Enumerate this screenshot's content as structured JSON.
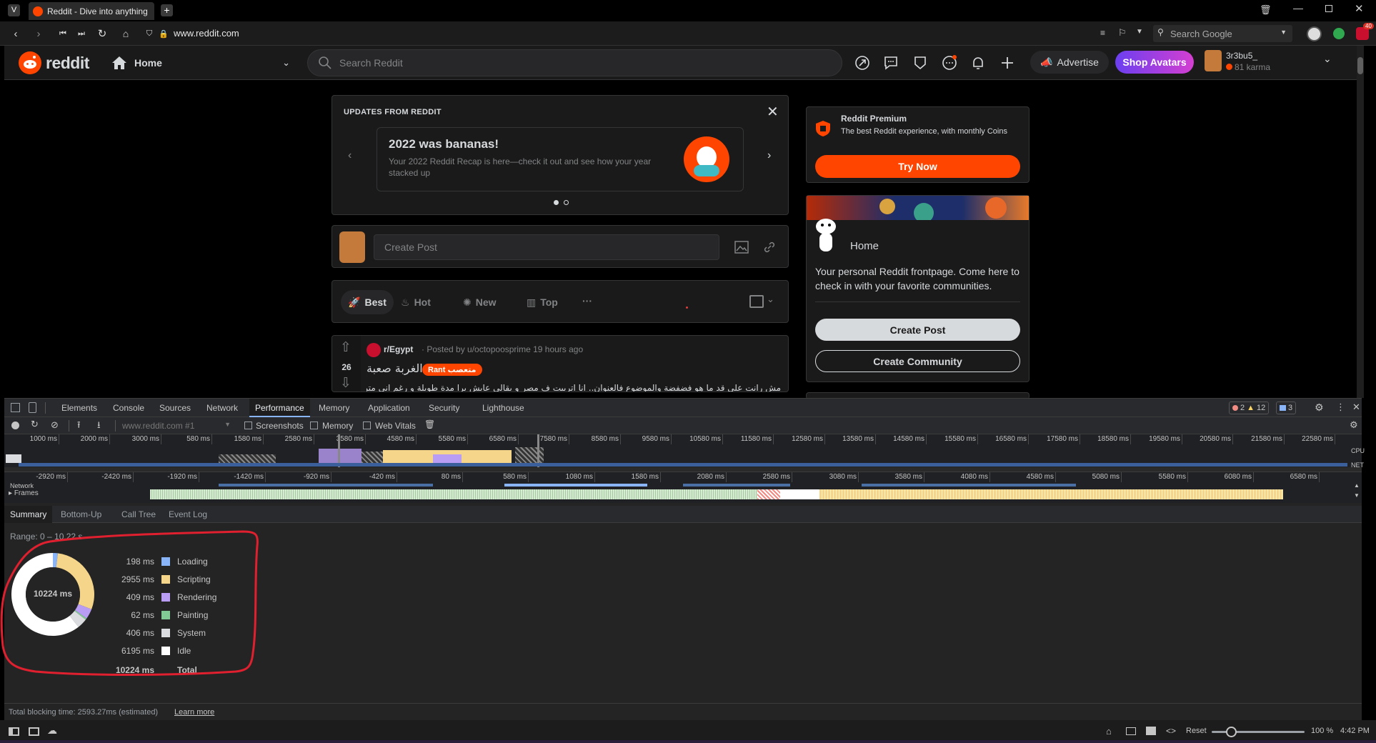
{
  "browser": {
    "tab_title": "Reddit - Dive into anything",
    "url": "www.reddit.com",
    "search_placeholder": "Search Google",
    "notification_count": "40"
  },
  "reddit_header": {
    "logo_text": "reddit",
    "home_label": "Home",
    "search_placeholder": "Search Reddit",
    "advertise_label": "Advertise",
    "shop_avatars_label": "Shop Avatars",
    "username": "3r3bu5_",
    "karma": "81 karma"
  },
  "updates": {
    "heading": "UPDATES FROM REDDIT",
    "title": "2022 was bananas!",
    "body": "Your 2022 Reddit Recap is here—check it out and see how your year stacked up"
  },
  "create_post": {
    "placeholder": "Create Post"
  },
  "sort": {
    "best": "Best",
    "hot": "Hot",
    "new": "New",
    "top": "Top",
    "more": "···"
  },
  "post": {
    "subreddit": "r/Egypt",
    "meta": "· Posted by u/octopoosprime 19 hours ago",
    "votes": "26",
    "title": "الغربة صعبة",
    "flair": "Rant متعصب",
    "body": "مش رانت على قد ما هو فضفضة والموضوع فالعنوان.. انا اتربيت ف مصر و بقالي عايش برا مدة طويلة و رغم اني متربي تربية"
  },
  "premium": {
    "title": "Reddit Premium",
    "body": "The best Reddit experience, with monthly Coins",
    "button": "Try Now"
  },
  "home_card": {
    "title": "Home",
    "body": "Your personal Reddit frontpage. Come here to check in with your favorite communities.",
    "create_post": "Create Post",
    "create_community": "Create Community"
  },
  "devtools": {
    "tabs": [
      "Elements",
      "Console",
      "Sources",
      "Network",
      "Performance",
      "Memory",
      "Application",
      "Security",
      "Lighthouse"
    ],
    "errors": "2",
    "warnings": "12",
    "messages": "3",
    "recording": "www.reddit.com #1",
    "screenshots": "Screenshots",
    "memory": "Memory",
    "web_vitals": "Web Vitals",
    "overview_ticks": [
      "1000 ms",
      "2000 ms",
      "3000 ms",
      "580 ms",
      "1580 ms",
      "2580 ms",
      "3580 ms",
      "4580 ms",
      "5580 ms",
      "6580 ms",
      "7580 ms",
      "8580 ms",
      "9580 ms",
      "10580 ms",
      "11580 ms",
      "12580 ms",
      "13580 ms",
      "14580 ms",
      "15580 ms",
      "16580 ms",
      "17580 ms",
      "18580 ms",
      "19580 ms",
      "20580 ms",
      "21580 ms",
      "22580 ms"
    ],
    "timeline_ticks": [
      "-2920 ms",
      "-2420 ms",
      "-1920 ms",
      "-1420 ms",
      "-920 ms",
      "-420 ms",
      "80 ms",
      "580 ms",
      "1080 ms",
      "1580 ms",
      "2080 ms",
      "2580 ms",
      "3080 ms",
      "3580 ms",
      "4080 ms",
      "4580 ms",
      "5080 ms",
      "5580 ms",
      "6080 ms",
      "6580 ms"
    ],
    "cpu": "CPU",
    "net": "NET",
    "network_label": "Network",
    "frames_label": "Frames",
    "summary_tabs": [
      "Summary",
      "Bottom-Up",
      "Call Tree",
      "Event Log"
    ],
    "range": "Range: 0 – 10.22 s",
    "total_center": "10224 ms",
    "breakdown": [
      {
        "value": "198 ms",
        "label": "Loading",
        "ms": 198,
        "color": "#8ab4f8"
      },
      {
        "value": "2955 ms",
        "label": "Scripting",
        "ms": 2955,
        "color": "#f5d58a"
      },
      {
        "value": "409 ms",
        "label": "Rendering",
        "ms": 409,
        "color": "#b99cf4"
      },
      {
        "value": "62 ms",
        "label": "Painting",
        "ms": 62,
        "color": "#81c995"
      },
      {
        "value": "406 ms",
        "label": "System",
        "ms": 406,
        "color": "#dadce0"
      },
      {
        "value": "6195 ms",
        "label": "Idle",
        "ms": 6195,
        "color": "#ffffff"
      }
    ],
    "total_value": "10224 ms",
    "total_label": "Total",
    "tbt": "Total blocking time: 2593.27ms (estimated)",
    "learn_more": "Learn more"
  },
  "statusbar": {
    "reset": "Reset",
    "zoom": "100 %",
    "time": "4:42 PM"
  }
}
